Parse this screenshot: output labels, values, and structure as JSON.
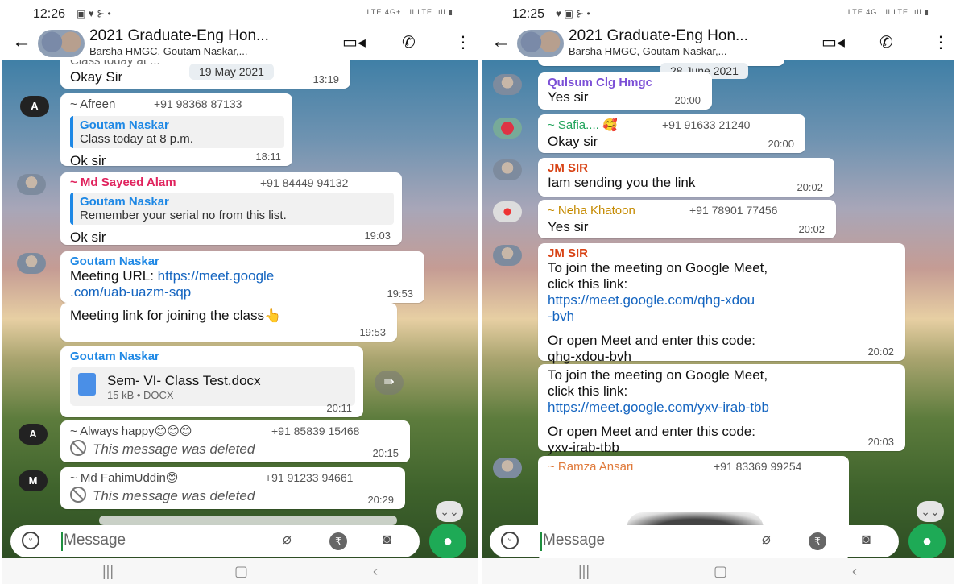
{
  "left": {
    "status": {
      "time": "12:26",
      "icons": "▣ ♥ ⊱ •",
      "right": "LTE 4G+ .ıll LTE .ıll ▮"
    },
    "header": {
      "title": "2021 Graduate-Eng Hon...",
      "subtitle": "Barsha HMGC, Goutam Naskar,..."
    },
    "messages": {
      "m0": {
        "partial": "Class today at ...",
        "text": "Okay Sir",
        "time": "13:19"
      },
      "date": "19 May 2021",
      "m1": {
        "avatar": "A",
        "sender": "~ Afreen",
        "phone": "+91 98368 87133",
        "qname": "Goutam Naskar",
        "qtext": "Class today at 8 p.m.",
        "text": "Ok sir",
        "time": "18:11"
      },
      "m2": {
        "sender": "~ Md Sayeed Alam",
        "phone": "+91 84449 94132",
        "qname": "Goutam Naskar",
        "qtext": "Remember your serial no from this list.",
        "text": "Ok sir",
        "time": "19:03"
      },
      "m3": {
        "sender": "Goutam Naskar",
        "text1": "Meeting URL: ",
        "link1": "https://meet.google",
        "link2": ".com/uab-uazm-sqp",
        "time": "19:53"
      },
      "m4": {
        "text": "Meeting link for joining the class👆",
        "time": "19:53"
      },
      "m5": {
        "sender": "Goutam Naskar",
        "docname": "Sem- VI- Class Test.docx",
        "docmeta": "15 kB • DOCX",
        "time": "20:11"
      },
      "m6": {
        "avatar": "A",
        "sender": "~ Always happy😊😊😊",
        "phone": "+91 85839 15468",
        "text": "This message was deleted",
        "time": "20:15"
      },
      "m7": {
        "avatar": "M",
        "sender": "~ Md FahimUddin😊",
        "phone": "+91 91233 94661",
        "text": "This message was deleted",
        "time": "20:29"
      }
    },
    "input": {
      "placeholder": "Message"
    }
  },
  "right": {
    "status": {
      "time": "12:25",
      "icons": "♥ ▣ ⊱ •",
      "right": "LTE 4G .ıll LTE .ıll ▮"
    },
    "header": {
      "title": "2021 Graduate-Eng Hon...",
      "subtitle": "Barsha HMGC, Goutam Naskar,..."
    },
    "messages": {
      "date": "28 June 2021",
      "m1": {
        "sender": "Qulsum Clg Hmgc",
        "text": "Yes sir",
        "time": "20:00"
      },
      "m2": {
        "sender": "~ Safia.... 🥰",
        "phone": "+91 91633 21240",
        "text": "Okay sir",
        "time": "20:00"
      },
      "m3": {
        "sender": "JM SIR",
        "text": "Iam sending you the link",
        "time": "20:02"
      },
      "m4": {
        "sender": "~ Neha Khatoon",
        "phone": "+91 78901 77456",
        "text": "Yes sir",
        "time": "20:02"
      },
      "m5": {
        "sender": "JM SIR",
        "l1": "To join the meeting on Google Meet,",
        "l2": "click this link:",
        "link1": "https://meet.google.com/qhg-xdou",
        "link2": "-bvh",
        "l3": "Or open Meet and enter this code:",
        "l4": "qhg-xdou-bvh",
        "time": "20:02"
      },
      "m6": {
        "l1": "To join the meeting on Google Meet,",
        "l2": "click this link:",
        "link": "https://meet.google.com/yxv-irab-tbb",
        "l3": "Or open Meet and enter this code:",
        "l4": "yxv-irab-tbb",
        "time": "20:03"
      },
      "m7": {
        "sender": "~ Ramza Ansari",
        "phone": "+91 83369 99254"
      }
    },
    "input": {
      "placeholder": "Message"
    }
  },
  "colors": {
    "link": "#1565c0",
    "accent": "#1eaa56",
    "quote": "#1e88e5"
  }
}
